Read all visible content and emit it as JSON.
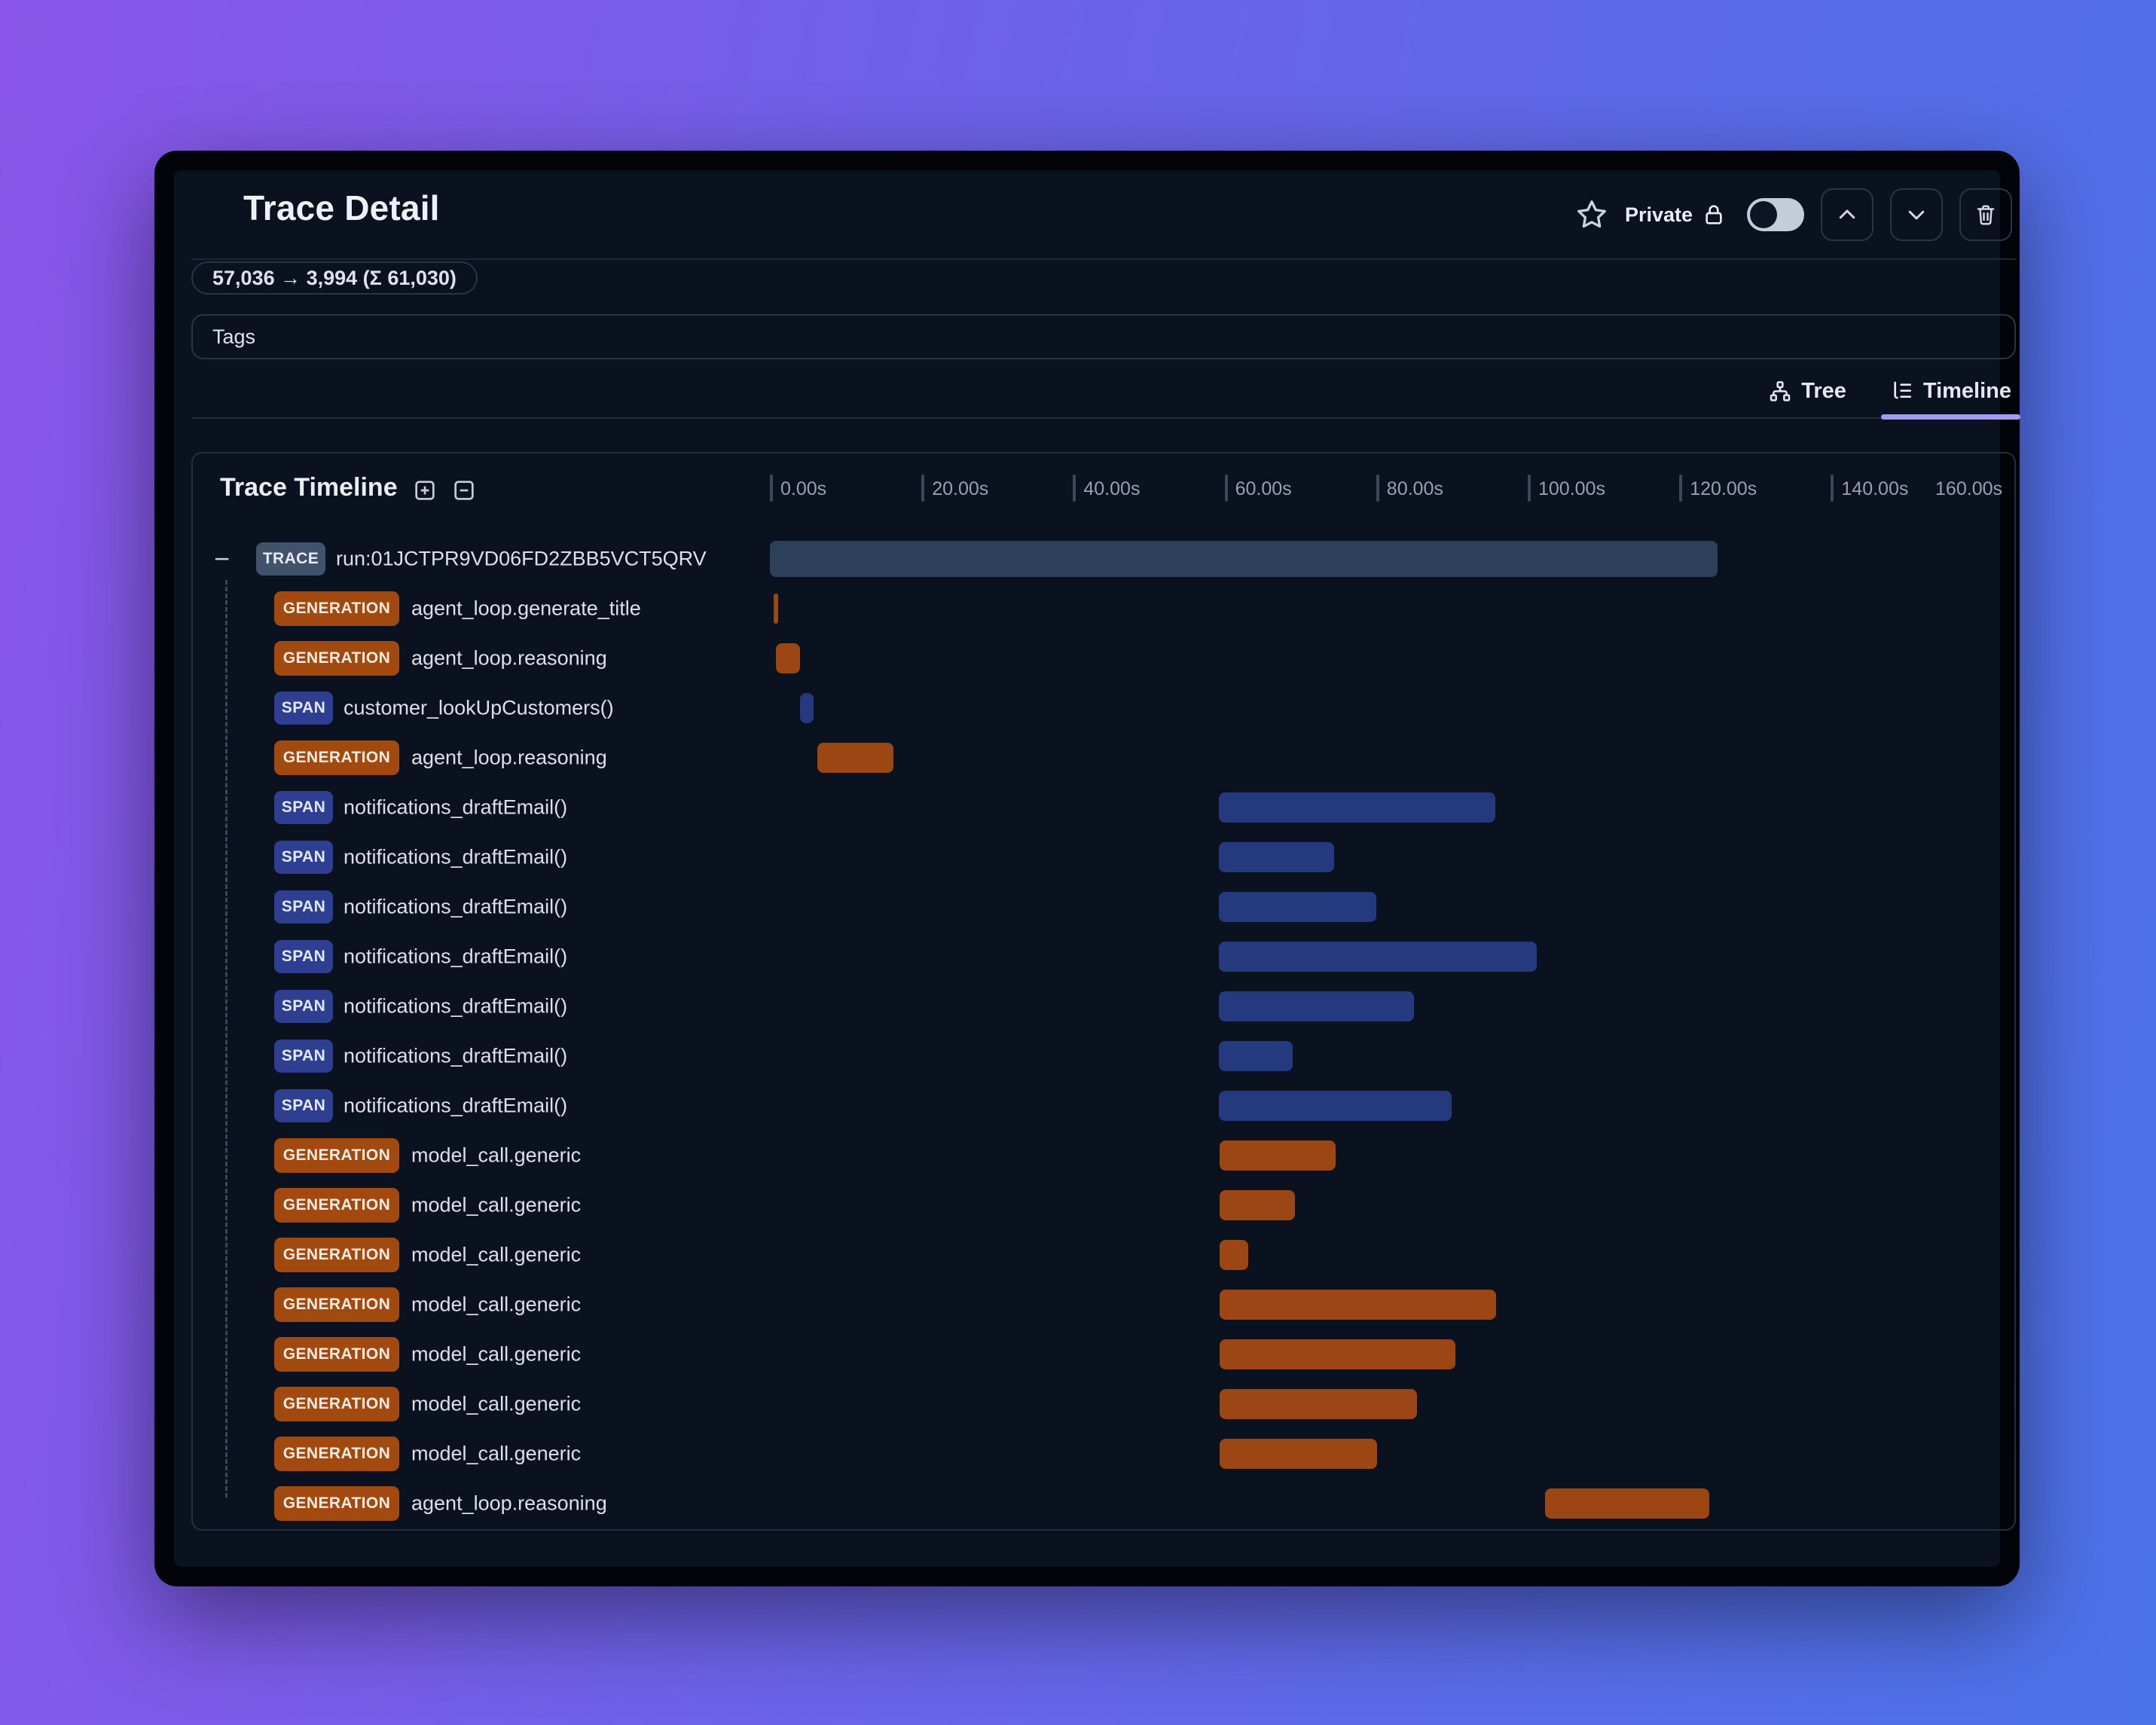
{
  "window": {
    "title": "Trace Detail"
  },
  "header": {
    "privacy_label": "Private",
    "privacy_toggle_on": false,
    "icons": [
      "star-icon",
      "lock-icon",
      "chevron-up-icon",
      "chevron-down-icon",
      "trash-icon"
    ]
  },
  "token_usage_badge": "57,036 → 3,994 (Σ 61,030)",
  "tags": {
    "label": "Tags"
  },
  "view_tabs": [
    {
      "label": "Tree",
      "icon": "tree-icon",
      "active": false
    },
    {
      "label": "Timeline",
      "icon": "timeline-icon",
      "active": true
    }
  ],
  "timeline_panel": {
    "title": "Trace Timeline",
    "expand_icon": "plus-square-icon",
    "collapse_icon": "minus-square-icon"
  },
  "chart_data": {
    "type": "gantt-timeline",
    "unit": "seconds",
    "axis": {
      "min": 0,
      "max": 160,
      "tick_step": 20,
      "tick_labels": [
        "0.00s",
        "20.00s",
        "40.00s",
        "60.00s",
        "80.00s",
        "100.00s",
        "120.00s",
        "140.00s",
        "160.00s"
      ]
    },
    "badge_colors": {
      "TRACE": "#42526d",
      "GENERATION": "#a1490f",
      "SPAN": "#2e3f92"
    },
    "bar_colors": {
      "TRACE": "#2e3f5a",
      "GENERATION": "#9c4614",
      "SPAN": "#253a7e"
    },
    "rows": [
      {
        "badge": "TRACE",
        "label": "run:01JCTPR9VD06FD2ZBB5VCT5QRV",
        "start": 0,
        "end": 125.0,
        "collapsible": true
      },
      {
        "badge": "GENERATION",
        "label": "agent_loop.generate_title",
        "start": 0.5,
        "end": 1.1
      },
      {
        "badge": "GENERATION",
        "label": "agent_loop.reasoning",
        "start": 0.8,
        "end": 4.0
      },
      {
        "badge": "SPAN",
        "label": "customer_lookUpCustomers()",
        "start": 4.0,
        "end": 5.8
      },
      {
        "badge": "GENERATION",
        "label": "agent_loop.reasoning",
        "start": 6.3,
        "end": 16.3
      },
      {
        "badge": "SPAN",
        "label": "notifications_draftEmail()",
        "start": 59.2,
        "end": 95.7
      },
      {
        "badge": "SPAN",
        "label": "notifications_draftEmail()",
        "start": 59.2,
        "end": 74.5
      },
      {
        "badge": "SPAN",
        "label": "notifications_draftEmail()",
        "start": 59.2,
        "end": 80.0
      },
      {
        "badge": "SPAN",
        "label": "notifications_draftEmail()",
        "start": 59.2,
        "end": 101.2
      },
      {
        "badge": "SPAN",
        "label": "notifications_draftEmail()",
        "start": 59.2,
        "end": 85.0
      },
      {
        "badge": "SPAN",
        "label": "notifications_draftEmail()",
        "start": 59.2,
        "end": 69.0
      },
      {
        "badge": "SPAN",
        "label": "notifications_draftEmail()",
        "start": 59.2,
        "end": 90.0
      },
      {
        "badge": "GENERATION",
        "label": "model_call.generic",
        "start": 59.3,
        "end": 74.7
      },
      {
        "badge": "GENERATION",
        "label": "model_call.generic",
        "start": 59.3,
        "end": 69.3
      },
      {
        "badge": "GENERATION",
        "label": "model_call.generic",
        "start": 59.3,
        "end": 63.1
      },
      {
        "badge": "GENERATION",
        "label": "model_call.generic",
        "start": 59.3,
        "end": 95.8
      },
      {
        "badge": "GENERATION",
        "label": "model_call.generic",
        "start": 59.3,
        "end": 90.5
      },
      {
        "badge": "GENERATION",
        "label": "model_call.generic",
        "start": 59.3,
        "end": 85.4
      },
      {
        "badge": "GENERATION",
        "label": "model_call.generic",
        "start": 59.3,
        "end": 80.1
      },
      {
        "badge": "GENERATION",
        "label": "agent_loop.reasoning",
        "start": 102.3,
        "end": 124.0
      }
    ]
  },
  "colors": {
    "background_gradient": [
      "#8a55e8",
      "#4a73e8"
    ],
    "modal_frame": "#020409",
    "content_bg": "#0a111f",
    "border": "#2b3447",
    "active_tab_underline": "#a49af0",
    "muted_text": "#97a0b3",
    "label_text": "#dbe0ea"
  }
}
